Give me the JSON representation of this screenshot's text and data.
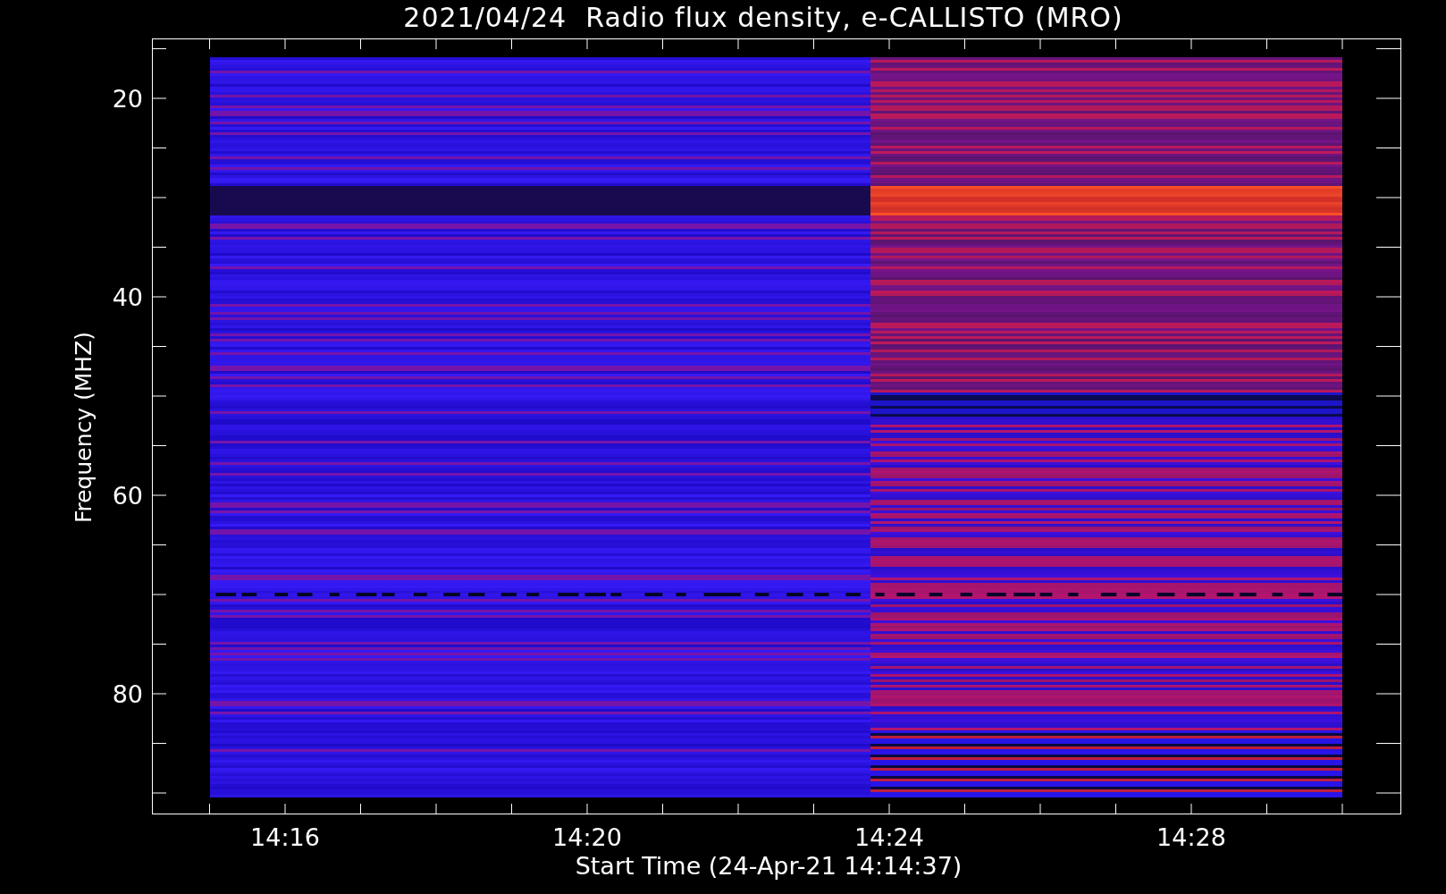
{
  "title": "2021/04/24  Radio flux density, e-CALLISTO (MRO)",
  "x_axis": {
    "label": "Start Time (24-Apr-21 14:14:37)",
    "ticks": [
      "14:16",
      "14:20",
      "14:24",
      "14:28"
    ]
  },
  "y_axis": {
    "label": "Frequency (MHZ)",
    "ticks": [
      "20",
      "40",
      "60",
      "80"
    ]
  }
}
